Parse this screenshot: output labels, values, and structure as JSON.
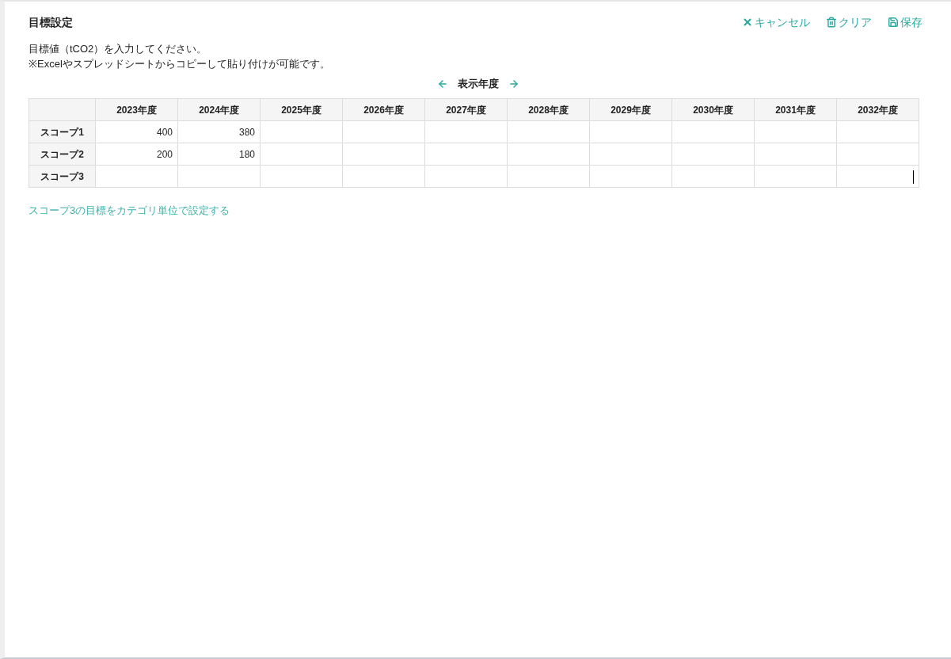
{
  "title": "目標設定",
  "actions": [
    {
      "kind": "cancel",
      "label": "キャンセル"
    },
    {
      "kind": "clear",
      "label": "クリア"
    },
    {
      "kind": "save",
      "label": "保存"
    }
  ],
  "instructions": [
    "目標値（tCO2）を入力してください。",
    "※Excelやスプレッドシートからコピーして貼り付けが可能です。"
  ],
  "year_nav": {
    "label": "表示年度"
  },
  "table": {
    "columns": [
      "2023年度",
      "2024年度",
      "2025年度",
      "2026年度",
      "2027年度",
      "2028年度",
      "2029年度",
      "2030年度",
      "2031年度",
      "2032年度"
    ],
    "rows": [
      {
        "label": "スコープ1",
        "cells": [
          {
            "value": "400",
            "focused": false
          },
          {
            "value": "380",
            "focused": false
          },
          {
            "focused": false
          },
          {
            "focused": false
          },
          {
            "focused": false
          },
          {
            "focused": false
          },
          {
            "focused": false
          },
          {
            "focused": false
          },
          {
            "focused": false
          },
          {
            "focused": false
          }
        ]
      },
      {
        "label": "スコープ2",
        "cells": [
          {
            "value": "200",
            "focused": false
          },
          {
            "value": "180",
            "focused": false
          },
          {
            "focused": false
          },
          {
            "focused": false
          },
          {
            "focused": false
          },
          {
            "focused": false
          },
          {
            "focused": false
          },
          {
            "focused": false
          },
          {
            "focused": false
          },
          {
            "focused": false
          }
        ]
      },
      {
        "label": "スコープ3",
        "cells": [
          {
            "focused": false
          },
          {
            "focused": false
          },
          {
            "focused": false
          },
          {
            "focused": false
          },
          {
            "focused": false
          },
          {
            "focused": false
          },
          {
            "focused": false
          },
          {
            "focused": false
          },
          {
            "focused": false
          },
          {
            "focused": true
          }
        ]
      }
    ]
  },
  "link": "スコープ3の目標をカテゴリ単位で設定する"
}
